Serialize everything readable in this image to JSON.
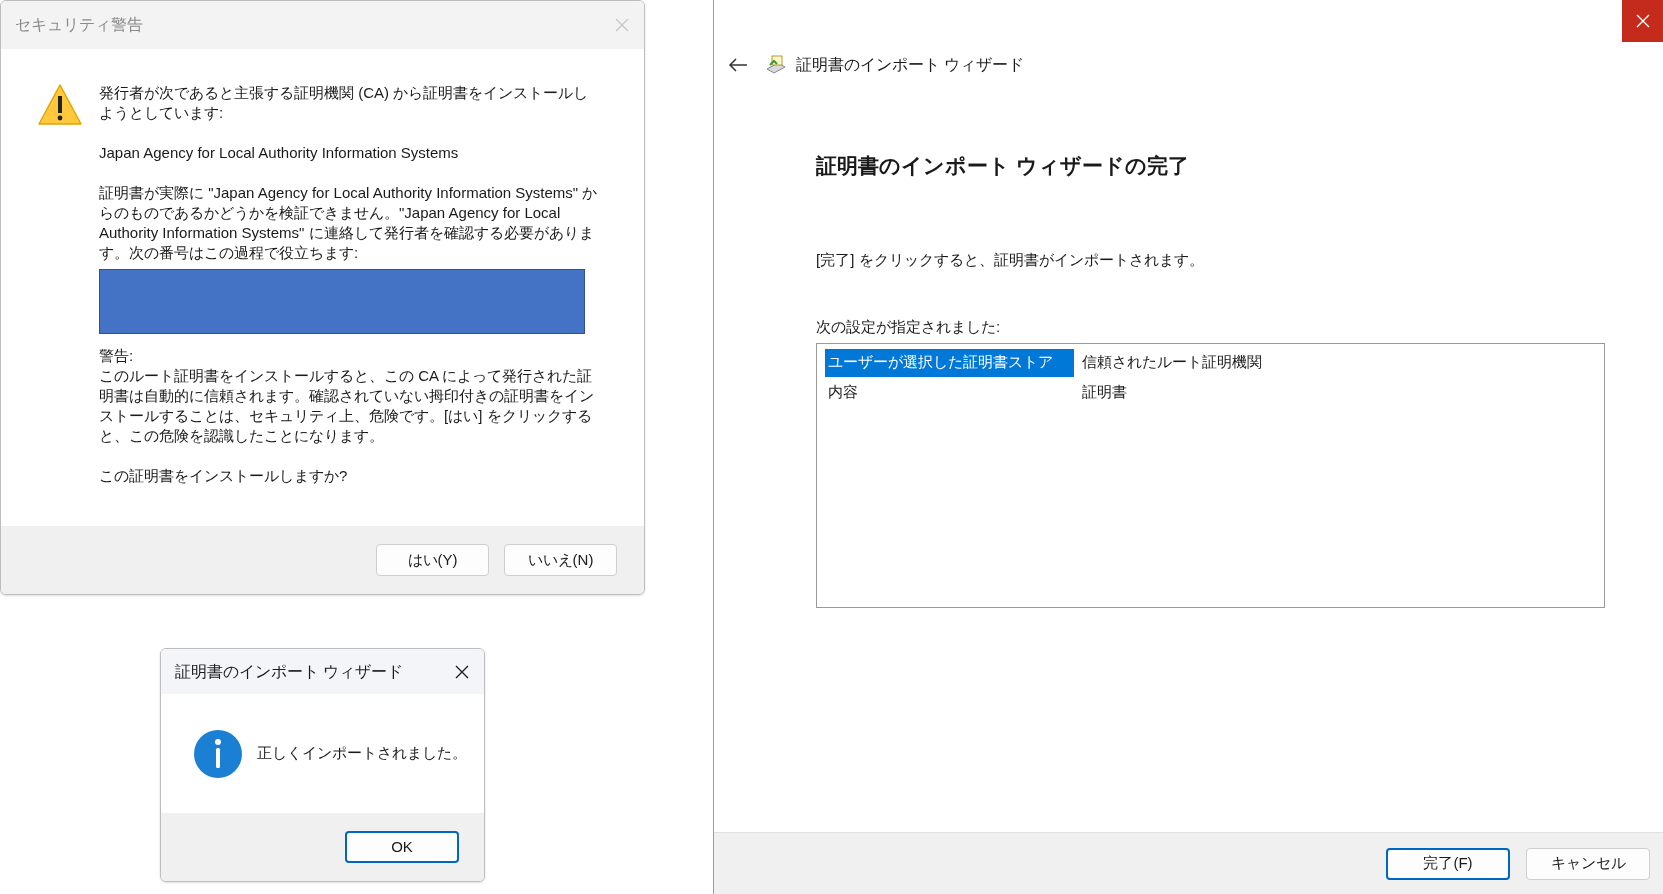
{
  "security_dialog": {
    "title": "セキュリティ警告",
    "close_disabled": true,
    "paragraphs": [
      "発行者が次であると主張する証明機関 (CA) から証明書をインストールしようとしています:",
      "Japan Agency for Local Authority Information Systems",
      "証明書が実際に \"Japan Agency for Local Authority Information Systems\" からのものであるかどうかを検証できません。\"Japan Agency for Local Authority Information Systems\" に連絡して発行者を確認する必要があります。次の番号はこの過程で役立ちます:"
    ],
    "warning_heading": "警告:",
    "warning_text": "このルート証明書をインストールすると、この CA によって発行された証明書は自動的に信頼されます。確認されていない拇印付きの証明書をインストールすることは、セキュリティ上、危険です。[はい] をクリックすると、この危険を認識したことになります。",
    "question": "この証明書をインストールしますか?",
    "buttons": [
      {
        "label": "はい(Y)",
        "default": false
      },
      {
        "label": "いいえ(N)",
        "default": false
      }
    ]
  },
  "info_dialog": {
    "title": "証明書のインポート ウィザード",
    "close_disabled": false,
    "message": "正しくインポートされました。",
    "buttons": [
      {
        "label": "OK",
        "default": true
      }
    ]
  },
  "wizard": {
    "title": "証明書のインポート ウィザード",
    "heading": "証明書のインポート ウィザードの完了",
    "instruction": "[完了] をクリックすると、証明書がインポートされます。",
    "settings_label": "次の設定が指定されました:",
    "settings_rows": [
      {
        "name": "ユーザーが選択した証明書ストア",
        "value": "信頼されたルート証明機関",
        "selected": true
      },
      {
        "name": "内容",
        "value": "証明書",
        "selected": false
      }
    ],
    "buttons": [
      {
        "label": "完了(F)",
        "default": true
      },
      {
        "label": "キャンセル",
        "default": false
      }
    ]
  }
}
